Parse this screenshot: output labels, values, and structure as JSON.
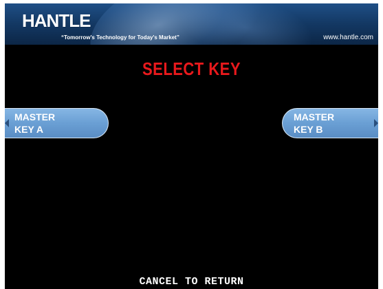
{
  "header": {
    "logo": "HANTLE",
    "tagline": "“Tomorrow's Technology for Today's Market”",
    "website": "www.hantle.com"
  },
  "screen": {
    "title": "SELECT KEY",
    "buttons": {
      "left": {
        "label": "MASTER\nKEY A"
      },
      "right": {
        "label": "MASTER\nKEY B"
      }
    },
    "footer": "CANCEL TO RETURN"
  },
  "colors": {
    "background": "#000000",
    "title": "#e8191c",
    "button": "#6a9fd4",
    "header": "#143a66"
  }
}
